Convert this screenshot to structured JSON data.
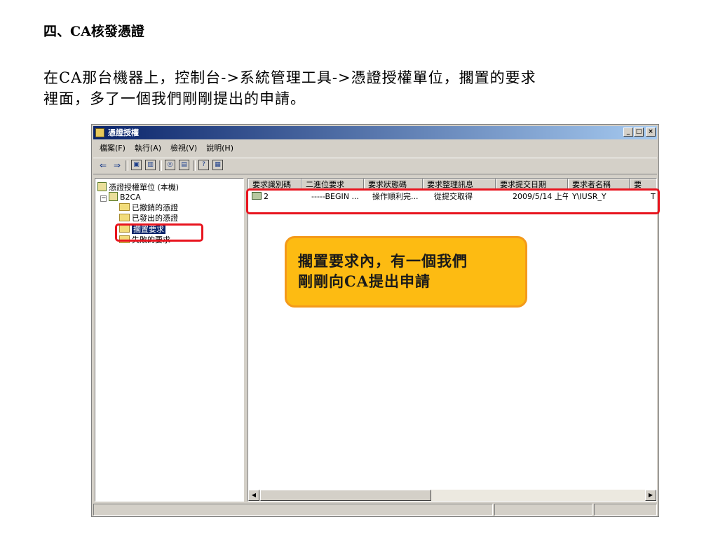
{
  "heading": "四、CA核發憑證",
  "paragraph": {
    "line1": "在CA那台機器上，控制台->系統管理工具->憑證授權單位，擱置的要求",
    "line2": "裡面，多了一個我們剛剛提出的申請。"
  },
  "window": {
    "title": "憑證授權",
    "controls": {
      "minimize": "_",
      "maximize": "□",
      "close": "×"
    },
    "menu": [
      "檔案(F)",
      "執行(A)",
      "檢視(V)",
      "說明(H)"
    ]
  },
  "tree": {
    "root": "憑證授權單位 (本機)",
    "ca": "B2CA",
    "expander": "−",
    "children": [
      "已撤銷的憑證",
      "已發出的憑證",
      "擱置要求",
      "失敗的要求"
    ]
  },
  "list": {
    "columns": [
      "要求識別碼",
      "二進位要求",
      "要求狀態碼",
      "要求整理訊息",
      "要求提交日期",
      "要求者名稱",
      "要"
    ],
    "rows": [
      [
        "2",
        "-----BEGIN ...",
        "操作順利完...",
        "從提交取得",
        "2009/5/14 上午...",
        "Y\\IUSR_Y",
        "T"
      ]
    ]
  },
  "scrollbar": {
    "left_arrow": "◀",
    "right_arrow": "▶"
  },
  "callout": {
    "line1": "擱置要求內，有一個我們",
    "line2": "剛剛向CA提出申請"
  },
  "colors": {
    "highlight": "#e8141e",
    "callout_fill": "#fdbb12",
    "titlebar": "#0a246a"
  }
}
